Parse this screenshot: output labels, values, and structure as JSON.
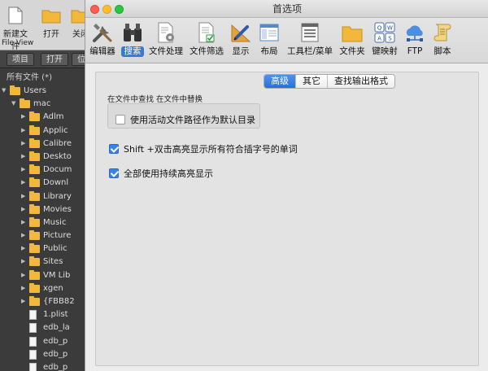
{
  "background_window": {
    "toolbar": {
      "new_file_label": "新建文件",
      "open_label": "打开",
      "close_label": "关闭",
      "file_view_label": "File View"
    },
    "tabs": [
      "项目",
      "打开",
      "位"
    ],
    "all_files_label": "所有文件 (*)",
    "tree": [
      {
        "label": "Users",
        "kind": "folder",
        "indent": 1,
        "open": true
      },
      {
        "label": "mac",
        "kind": "folder",
        "indent": 2,
        "open": true
      },
      {
        "label": "Adlm",
        "kind": "folder",
        "indent": 3
      },
      {
        "label": "Applic",
        "kind": "folder",
        "indent": 3
      },
      {
        "label": "Calibre",
        "kind": "folder",
        "indent": 3
      },
      {
        "label": "Deskto",
        "kind": "folder",
        "indent": 3
      },
      {
        "label": "Docum",
        "kind": "folder",
        "indent": 3
      },
      {
        "label": "Downl",
        "kind": "folder",
        "indent": 3
      },
      {
        "label": "Library",
        "kind": "folder",
        "indent": 3
      },
      {
        "label": "Movies",
        "kind": "folder",
        "indent": 3
      },
      {
        "label": "Music",
        "kind": "folder",
        "indent": 3
      },
      {
        "label": "Picture",
        "kind": "folder",
        "indent": 3
      },
      {
        "label": "Public",
        "kind": "folder",
        "indent": 3
      },
      {
        "label": "Sites",
        "kind": "folder",
        "indent": 3
      },
      {
        "label": "VM Lib",
        "kind": "folder",
        "indent": 3
      },
      {
        "label": "xgen",
        "kind": "folder",
        "indent": 3
      },
      {
        "label": "{FBB82",
        "kind": "folder",
        "indent": 3
      },
      {
        "label": "1.plist",
        "kind": "file",
        "indent": 3
      },
      {
        "label": "edb_la",
        "kind": "file",
        "indent": 3
      },
      {
        "label": "edb_p",
        "kind": "file",
        "indent": 3
      },
      {
        "label": "edb_p",
        "kind": "file",
        "indent": 3
      },
      {
        "label": "edb_p",
        "kind": "file",
        "indent": 3
      }
    ]
  },
  "window": {
    "title": "首选项"
  },
  "toolbar": {
    "items": [
      {
        "id": "editor",
        "label": "编辑器",
        "icon": "tools-icon"
      },
      {
        "id": "search",
        "label": "搜索",
        "icon": "binoculars-icon",
        "active": true
      },
      {
        "id": "file-processing",
        "label": "文件处理",
        "icon": "document-gear-icon"
      },
      {
        "id": "file-filter",
        "label": "文件筛选",
        "icon": "document-check-icon"
      },
      {
        "id": "display",
        "label": "显示",
        "icon": "pen-ruler-icon"
      },
      {
        "id": "layout",
        "label": "布局",
        "icon": "window-layout-icon"
      },
      {
        "id": "toolbar-menu",
        "label": "工具栏/菜单",
        "icon": "menu-list-icon"
      },
      {
        "id": "folders",
        "label": "文件夹",
        "icon": "folder-icon"
      },
      {
        "id": "keymap",
        "label": "键映射",
        "icon": "keyboard-keys-icon"
      },
      {
        "id": "ftp",
        "label": "FTP",
        "icon": "cloud-network-icon"
      },
      {
        "id": "script",
        "label": "脚本",
        "icon": "scroll-icon"
      }
    ]
  },
  "segments": [
    {
      "label": "高级",
      "selected": true
    },
    {
      "label": "其它",
      "selected": false
    },
    {
      "label": "查找输出格式",
      "selected": false
    }
  ],
  "section_label": "在文件中查找 在文件中替换",
  "options": {
    "use_active_path": {
      "label": "使用活动文件路径作为默认目录",
      "checked": false
    },
    "shift_double_click": {
      "label": "Shift +双击高亮显示所有符合插字号的单词",
      "checked": true
    },
    "persistent_highlight": {
      "label": "全部使用持续高亮显示",
      "checked": true
    }
  },
  "colors": {
    "accent": "#3a78d6",
    "folder": "#f2b83c",
    "sidebar_bg": "#3b3b3b",
    "panel_bg": "#ececec"
  }
}
